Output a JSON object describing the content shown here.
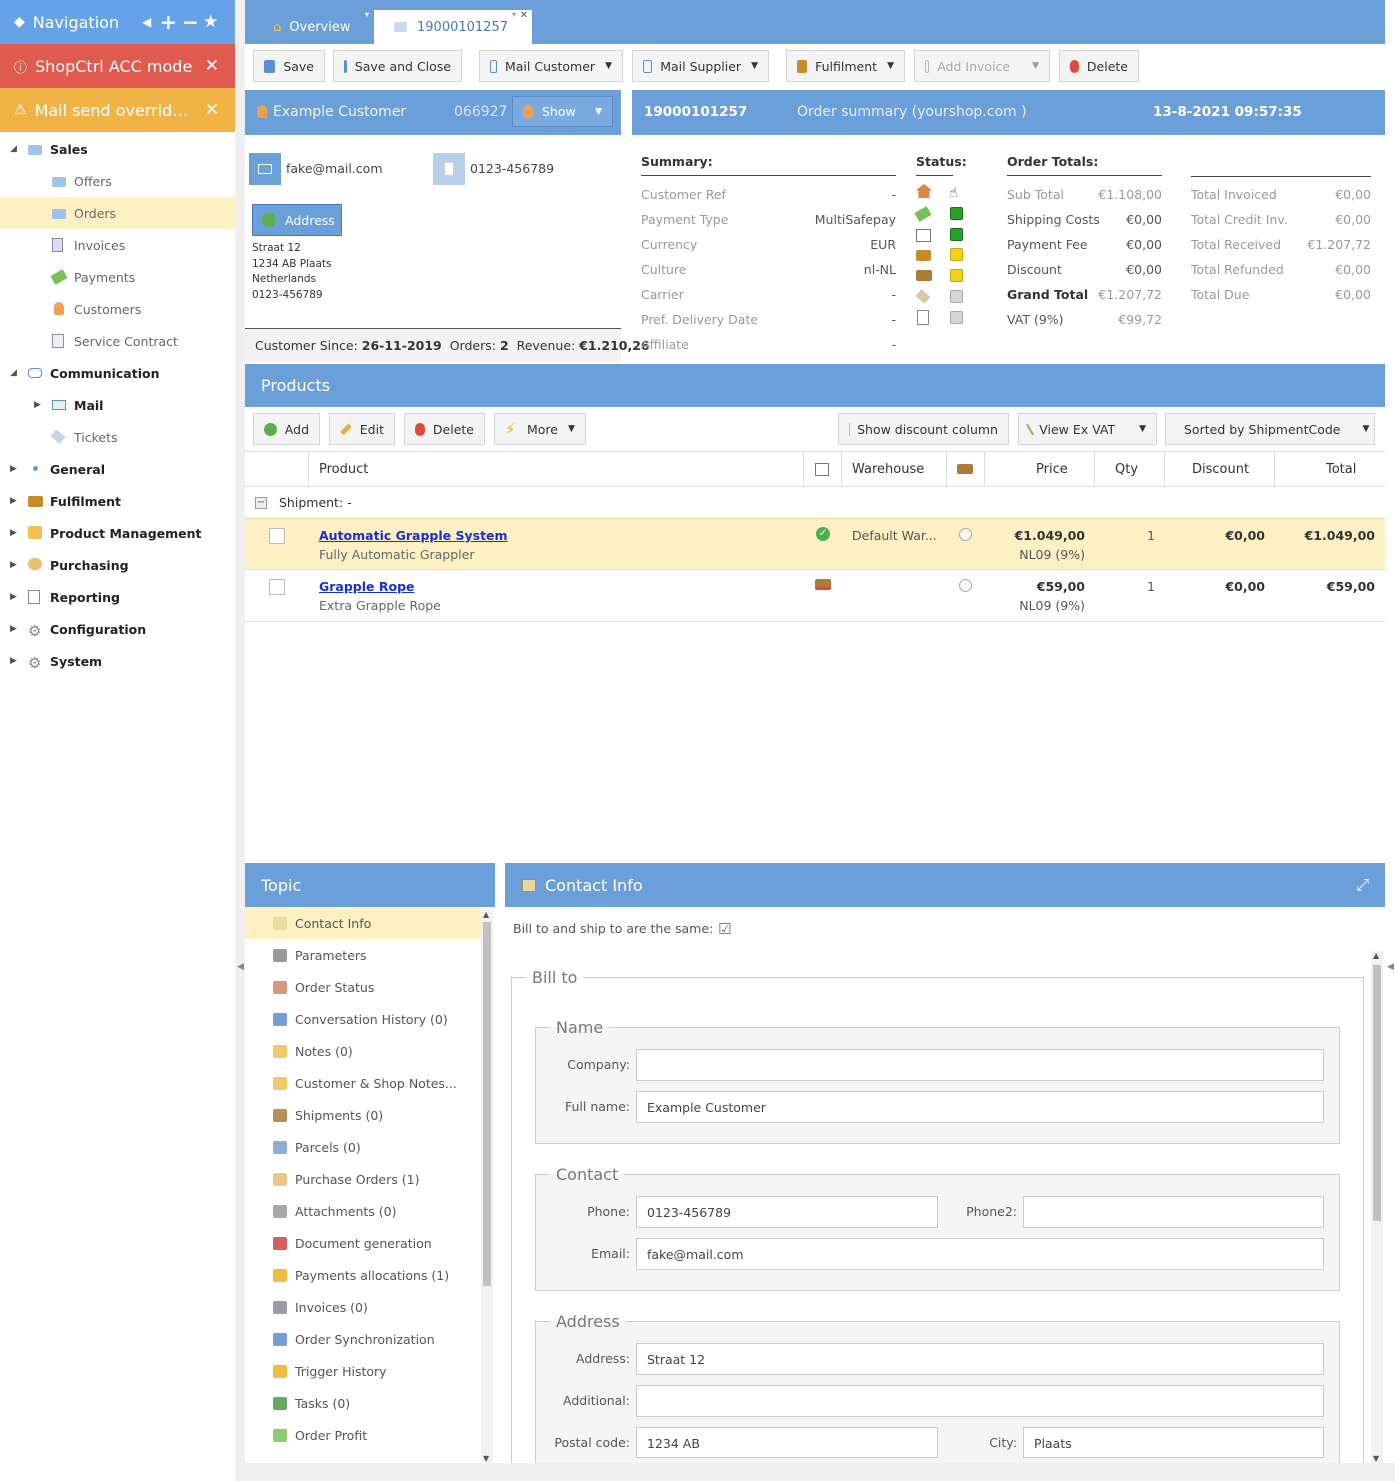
{
  "colors": {
    "accent": "#6b9fd9",
    "nav_bg": "#65a2e7",
    "acc_bg": "#e05a4f",
    "mail_bg": "#f0b446",
    "selected_bg": "#fdf0c2"
  },
  "nav": {
    "title": "Navigation",
    "acc_mode": "ShopCtrl ACC mode",
    "mail_override": "Mail send override ..."
  },
  "sidebar": {
    "sales": "Sales",
    "offers": "Offers",
    "orders": "Orders",
    "invoices": "Invoices",
    "payments": "Payments",
    "customers": "Customers",
    "service_contract": "Service Contract",
    "communication": "Communication",
    "mail": "Mail",
    "tickets": "Tickets",
    "general": "General",
    "fulfilment": "Fulfilment",
    "product_management": "Product Management",
    "purchasing": "Purchasing",
    "reporting": "Reporting",
    "configuration": "Configuration",
    "system": "System"
  },
  "tabs": {
    "overview": "Overview",
    "order": "19000101257"
  },
  "toolbar": {
    "save": "Save",
    "save_close": "Save and Close",
    "mail_customer": "Mail Customer",
    "mail_supplier": "Mail Supplier",
    "fulfilment": "Fulfilment",
    "add_invoice": "Add Invoice",
    "delete": "Delete"
  },
  "customer": {
    "name": "Example Customer",
    "number": "066927",
    "show": "Show",
    "email": "fake@mail.com",
    "phone": "0123-456789",
    "address_btn": "Address",
    "addr1": "Straat 12",
    "addr2": "1234 AB Plaats",
    "addr3": "Netherlands",
    "addr4": "0123-456789",
    "since_label": "Customer Since:",
    "since": "26-11-2019",
    "orders_label": "Orders:",
    "orders": "2",
    "revenue_label": "Revenue:",
    "revenue": "€1.210,26"
  },
  "order": {
    "number": "19000101257",
    "summary_title": "Order summary (yourshop.com )",
    "datetime": "13-8-2021 09:57:35",
    "summary_h": "Summary:",
    "status_h": "Status:",
    "totals_h": "Order Totals:",
    "summary": [
      {
        "label": "Customer Ref",
        "value": "-"
      },
      {
        "label": "Payment Type",
        "value": "MultiSafepay"
      },
      {
        "label": "Currency",
        "value": "EUR"
      },
      {
        "label": "Culture",
        "value": "nl-NL"
      },
      {
        "label": "Carrier",
        "value": "-"
      },
      {
        "label": "Pref. Delivery Date",
        "value": "-"
      },
      {
        "label": "Affiliate",
        "value": "-"
      }
    ],
    "totals": [
      {
        "label": "Sub Total",
        "value": "€1.108,00"
      },
      {
        "label": "Shipping Costs",
        "value": "€0,00"
      },
      {
        "label": "Payment Fee",
        "value": "€0,00"
      },
      {
        "label": "Discount",
        "value": "€0,00"
      },
      {
        "label": "Grand Total",
        "value": "€1.207,72"
      },
      {
        "label": "VAT (9%)",
        "value": "€99,72"
      }
    ],
    "totals2": [
      {
        "label": "Total Invoiced",
        "value": "€0,00"
      },
      {
        "label": "Total Credit Inv.",
        "value": "€0,00"
      },
      {
        "label": "Total Received",
        "value": "€1.207,72"
      },
      {
        "label": "Total Refunded",
        "value": "€0,00"
      },
      {
        "label": "Total Due",
        "value": "€0,00"
      }
    ]
  },
  "products": {
    "title": "Products",
    "add": "Add",
    "edit": "Edit",
    "delete": "Delete",
    "more": "More",
    "show_discount": "Show discount column",
    "view_ex_vat": "View Ex VAT",
    "sorted": "Sorted by ShipmentCode",
    "cols": {
      "product": "Product",
      "warehouse": "Warehouse",
      "price": "Price",
      "qty": "Qty",
      "discount": "Discount",
      "total": "Total"
    },
    "shipment": "Shipment: -",
    "rows": [
      {
        "name": "Automatic Grapple System",
        "desc": "Fully Automatic Grappler",
        "warehouse": "Default War...",
        "price": "€1.049,00",
        "vat": "NL09 (9%)",
        "qty": "1",
        "discount": "€0,00",
        "total": "€1.049,00"
      },
      {
        "name": "Grapple Rope",
        "desc": "Extra Grapple Rope",
        "warehouse": "",
        "price": "€59,00",
        "vat": "NL09 (9%)",
        "qty": "1",
        "discount": "€0,00",
        "total": "€59,00"
      }
    ]
  },
  "topic": {
    "title": "Topic",
    "items": [
      "Contact Info",
      "Parameters",
      "Order Status",
      "Conversation History (0)",
      "Notes (0)",
      "Customer & Shop Notes...",
      "Shipments (0)",
      "Parcels (0)",
      "Purchase Orders (1)",
      "Attachments (0)",
      "Document generation",
      "Payments allocations (1)",
      "Invoices (0)",
      "Order Synchronization",
      "Trigger History",
      "Tasks (0)",
      "Order Profit"
    ]
  },
  "contact": {
    "title": "Contact Info",
    "same_label": "Bill to and ship to are the same:",
    "bill_to": "Bill to",
    "name_legend": "Name",
    "company_label": "Company:",
    "company": "",
    "fullname_label": "Full name:",
    "fullname": "Example Customer",
    "contact_legend": "Contact",
    "phone_label": "Phone:",
    "phone": "0123-456789",
    "phone2_label": "Phone2:",
    "phone2": "",
    "email_label": "Email:",
    "email": "fake@mail.com",
    "address_legend": "Address",
    "address_label": "Address:",
    "address": "Straat 12",
    "additional_label": "Additional:",
    "additional": "",
    "postal_label": "Postal code:",
    "postal": "1234 AB",
    "city_label": "City:",
    "city": "Plaats"
  }
}
